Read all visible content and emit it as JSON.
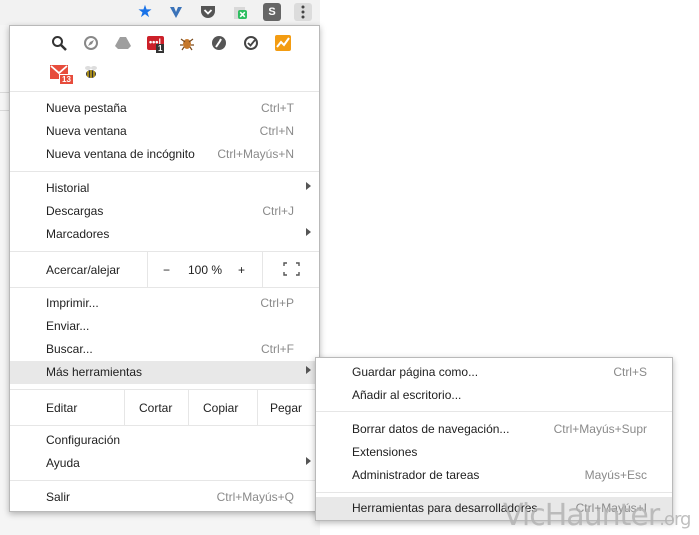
{
  "toolbar": {
    "icons": [
      "star-icon",
      "vivaldi-v-icon",
      "pocket-icon",
      "evernote-clip-icon",
      "s-extension-icon",
      "menu-kebab-icon"
    ],
    "colors": {
      "star": "#1a73e8",
      "vee": "#3b73b9",
      "pocket": "#5a5a5a",
      "s": "#6b6b6b"
    }
  },
  "extensions": {
    "row1": [
      "magnifier-icon",
      "compass-icon",
      "cloud-drive-icon",
      "lastpass-icon",
      "bug-icon",
      "speed-icon",
      "clock-check-icon",
      "chart-icon"
    ],
    "row2": [
      "gmail-icon",
      "bee-icon"
    ],
    "lastpass_badge": "1",
    "gmail_badge": "13"
  },
  "menu": {
    "new_tab": {
      "label": "Nueva pestaña",
      "shortcut": "Ctrl+T"
    },
    "new_window": {
      "label": "Nueva ventana",
      "shortcut": "Ctrl+N"
    },
    "incognito": {
      "label": "Nueva ventana de incógnito",
      "shortcut": "Ctrl+Mayús+N"
    },
    "history": {
      "label": "Historial"
    },
    "downloads": {
      "label": "Descargas",
      "shortcut": "Ctrl+J"
    },
    "bookmarks": {
      "label": "Marcadores"
    },
    "zoom": {
      "label": "Acercar/alejar",
      "minus": "−",
      "value": "100 %",
      "plus": "+"
    },
    "print": {
      "label": "Imprimir...",
      "shortcut": "Ctrl+P"
    },
    "cast": {
      "label": "Enviar..."
    },
    "find": {
      "label": "Buscar...",
      "shortcut": "Ctrl+F"
    },
    "more_tools": {
      "label": "Más herramientas"
    },
    "edit": {
      "label": "Editar",
      "cut": "Cortar",
      "copy": "Copiar",
      "paste": "Pegar"
    },
    "settings": {
      "label": "Configuración"
    },
    "help": {
      "label": "Ayuda"
    },
    "exit": {
      "label": "Salir",
      "shortcut": "Ctrl+Mayús+Q"
    }
  },
  "submenu": {
    "save_page": {
      "label": "Guardar página como...",
      "shortcut": "Ctrl+S"
    },
    "add_desktop": {
      "label": "Añadir al escritorio..."
    },
    "clear_data": {
      "label": "Borrar datos de navegación...",
      "shortcut": "Ctrl+Mayús+Supr"
    },
    "extensions": {
      "label": "Extensiones"
    },
    "task_manager": {
      "label": "Administrador de tareas",
      "shortcut": "Mayús+Esc"
    },
    "dev_tools": {
      "label": "Herramientas para desarrolladores",
      "shortcut": "Ctrl+Mayús+I"
    }
  },
  "watermark": {
    "main": "VicHaunter",
    "tld": ".org"
  }
}
